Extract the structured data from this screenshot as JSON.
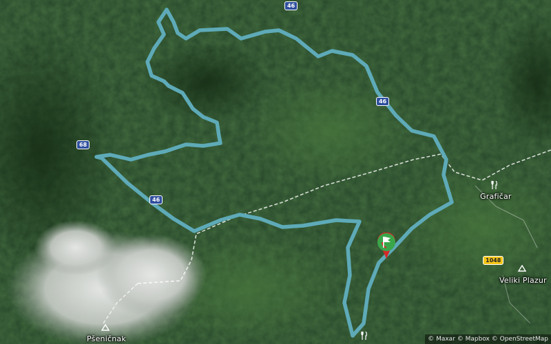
{
  "map": {
    "place_labels": {
      "graficar": "Grafičar",
      "veliki_plazur": "Veliki Plazur",
      "psenicnak": "Pšeničnak"
    },
    "road_shields": {
      "r46_top": "46",
      "r46_mid": "46",
      "r68": "68",
      "r46_lower": "46",
      "r1048": "1048"
    },
    "attribution": "© Maxar © Mapbox © OpenStreetMap",
    "icons": {
      "graficar_poi": "restaurant-icon",
      "bottom_poi": "restaurant-icon",
      "veliki_plazur_poi": "peak-icon",
      "psenicnak_poi": "peak-icon",
      "start_marker": "flag-marker-icon"
    },
    "colors": {
      "route": "#5eaab8",
      "forest_dark": "#1e3a1c",
      "forest_light": "#3d6b33",
      "shield_blue": "#2f4f9e",
      "shield_yellow": "#f5c518",
      "marker_green": "#3aa64a",
      "marker_red": "#d62828"
    }
  }
}
